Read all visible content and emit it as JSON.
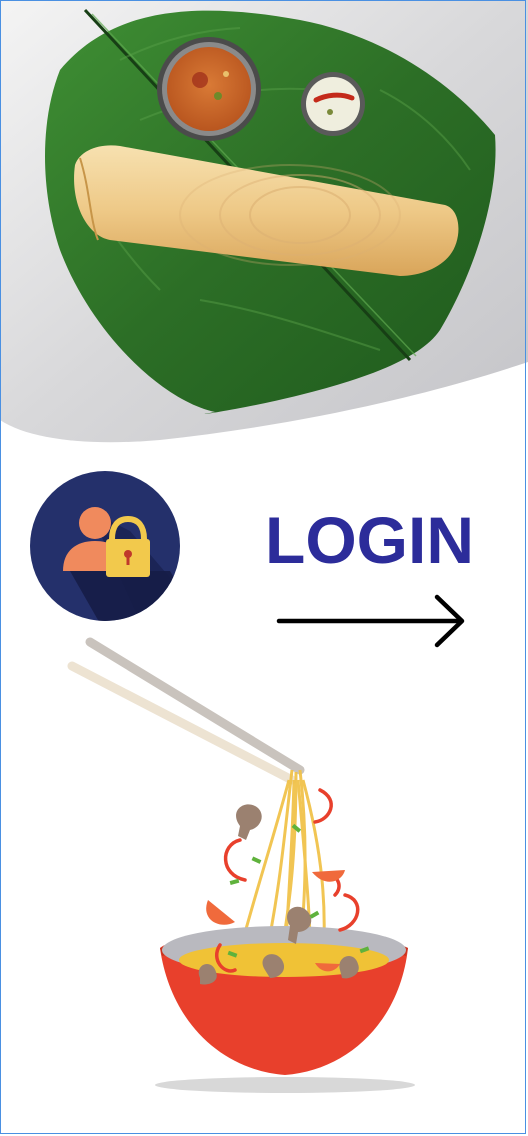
{
  "hero": {
    "image": "dosa-on-banana-leaf"
  },
  "login": {
    "title": "LOGIN",
    "user_icon": "user-lock-icon",
    "arrow_icon": "arrow-right-icon"
  },
  "illustration": {
    "image": "noodle-bowl-with-chopsticks"
  },
  "colors": {
    "title": "#2c2c9a",
    "badge_bg": "#24306b",
    "bowl": "#e8402c",
    "leaf": "#2f7a2a"
  }
}
